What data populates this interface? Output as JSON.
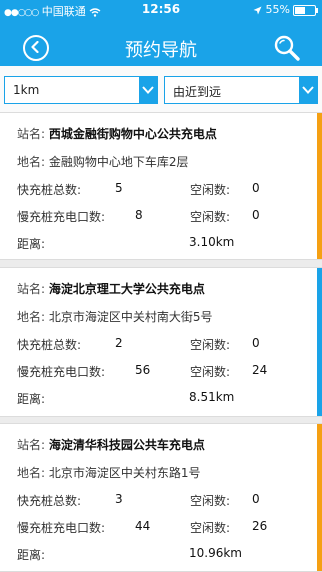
{
  "status_bar": {
    "carrier": "中国联通",
    "time": "12:56",
    "battery": "55%",
    "battery_level": 0.55
  },
  "header": {
    "title": "预约导航"
  },
  "filters": {
    "distance": "1km",
    "sort": "由近到远"
  },
  "labels": {
    "station": "站名:",
    "address": "地名:",
    "fast_total": "快充桩总数:",
    "free": "空闲数:",
    "slow_total": "慢充桩充电口数:",
    "distance": "距离:"
  },
  "stations": [
    {
      "name": "西城金融街购物中心公共充电点",
      "address": "金融购物中心地下车库2层",
      "fast_total": "5",
      "fast_free": "0",
      "slow_total": "8",
      "slow_free": "0",
      "distance": "3.10km",
      "accent": "#f5a013"
    },
    {
      "name": "海淀北京理工大学公共充电点",
      "address": "北京市海淀区中关村南大街5号",
      "fast_total": "2",
      "fast_free": "0",
      "slow_total": "56",
      "slow_free": "24",
      "distance": "8.51km",
      "accent": "#1aa3e8"
    },
    {
      "name": "海淀清华科技园公共车充电点",
      "address": "北京市海淀区中关村东路1号",
      "fast_total": "3",
      "fast_free": "0",
      "slow_total": "44",
      "slow_free": "26",
      "distance": "10.96km",
      "accent": "#f5a013"
    }
  ]
}
